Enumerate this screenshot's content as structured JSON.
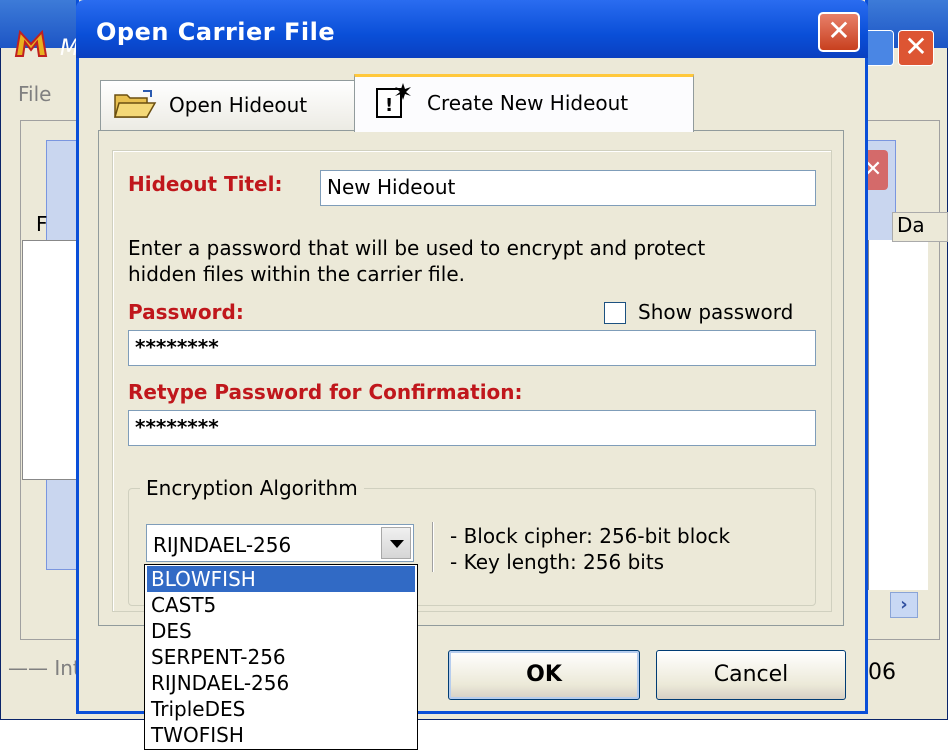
{
  "background_app": {
    "title_fragment": "M",
    "menu_file": "File",
    "column_fragment_left": "F",
    "column_fragment_right": "Da",
    "status_left": "—— Int",
    "status_right": "06",
    "scroll_arrow": "›"
  },
  "dialog": {
    "title": "Open Carrier File",
    "close_glyph": "✕"
  },
  "tabs": [
    {
      "label": "Open Hideout",
      "icon": "folder-open-icon",
      "selected": false
    },
    {
      "label": "Create New Hideout",
      "icon": "new-document-icon",
      "selected": true
    }
  ],
  "form": {
    "title_label": "Hideout Titel:",
    "title_value": "New Hideout",
    "instruction_line1": "Enter a password that will be used to encrypt and protect",
    "instruction_line2": "hidden files within the carrier file.",
    "password_label": "Password:",
    "password_value": "********",
    "show_password_label": "Show password",
    "show_password_checked": false,
    "confirm_label": "Retype Password for Confirmation:",
    "confirm_value": "********"
  },
  "encryption": {
    "group_label": "Encryption Algorithm",
    "selected": "RIJNDAEL-256",
    "info_line1": "- Block cipher: 256-bit block",
    "info_line2": "- Key length: 256 bits",
    "options": [
      "BLOWFISH",
      "CAST5",
      "DES",
      "SERPENT-256",
      "RIJNDAEL-256",
      "TripleDES",
      "TWOFISH"
    ],
    "highlighted_option": "BLOWFISH"
  },
  "buttons": {
    "ok": "OK",
    "cancel": "Cancel"
  },
  "colors": {
    "title_bar": "#0a4fd8",
    "required_label": "#c0171c",
    "highlight": "#316ac5",
    "dialog_bg": "#ece9d8"
  }
}
